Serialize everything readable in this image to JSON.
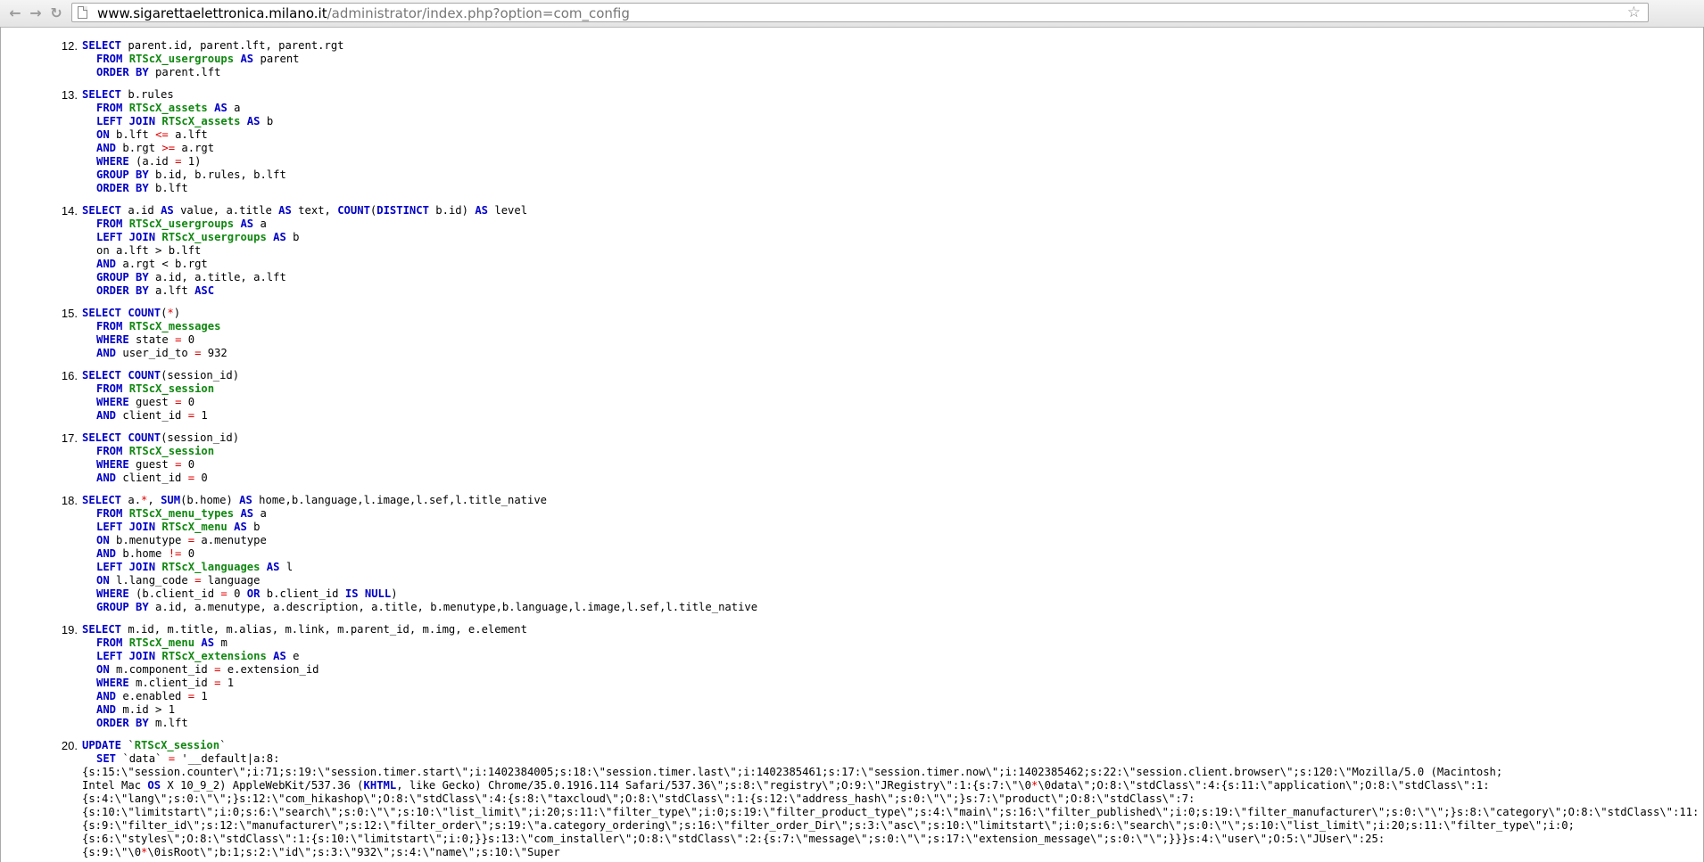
{
  "browser": {
    "url_host": "www.sigarettaelettronica.milano.it",
    "url_path": "/administrator/index.php?option=com_config",
    "back_icon": "arrow-left-icon",
    "forward_icon": "arrow-right-icon",
    "reload_icon": "reload-icon",
    "star_icon": "star-icon"
  },
  "colors": {
    "keyword": "#0000c8",
    "table": "#118811",
    "operator": "#e00000"
  },
  "queries": [
    {
      "num": "12.",
      "lines": [
        "[[SELECT]] parent.id, parent.lft, parent.rgt",
        "  [[FROM]] {{RTScX_usergroups}} [[AS]] parent",
        "  [[ORDER BY]] parent.lft"
      ]
    },
    {
      "num": "13.",
      "lines": [
        "[[SELECT]] b.rules",
        "  [[FROM]] {{RTScX_assets}} [[AS]] a",
        "  [[LEFT JOIN]] {{RTScX_assets}} [[AS]] b",
        "  [[ON]] b.lft <= a.lft",
        "  [[AND]] b.rgt >= a.rgt",
        "  [[WHERE]] (a.id = 1)",
        "  [[GROUP BY]] b.id, b.rules, b.lft",
        "  [[ORDER BY]] b.lft"
      ]
    },
    {
      "num": "14.",
      "lines": [
        "[[SELECT]] a.id [[AS]] value, a.title [[AS]] text, [[COUNT]]([[DISTINCT]] b.id) [[AS]] level",
        "  [[FROM]] {{RTScX_usergroups}} [[AS]] a",
        "  [[LEFT JOIN]] {{RTScX_usergroups}} [[AS]] b",
        "  on a.lft > b.lft",
        "  [[AND]] a.rgt < b.rgt",
        "  [[GROUP BY]] a.id, a.title, a.lft",
        "  [[ORDER BY]] a.lft [[ASC]]"
      ]
    },
    {
      "num": "15.",
      "lines": [
        "[[SELECT]] [[COUNT]](*)",
        "  [[FROM]] {{RTScX_messages}}",
        "  [[WHERE]] state = 0",
        "  [[AND]] user_id_to = 932"
      ]
    },
    {
      "num": "16.",
      "lines": [
        "[[SELECT]] [[COUNT]](session_id)",
        "  [[FROM]] {{RTScX_session}}",
        "  [[WHERE]] guest = 0",
        "  [[AND]] client_id = 1"
      ]
    },
    {
      "num": "17.",
      "lines": [
        "[[SELECT]] [[COUNT]](session_id)",
        "  [[FROM]] {{RTScX_session}}",
        "  [[WHERE]] guest = 0",
        "  [[AND]] client_id = 0"
      ]
    },
    {
      "num": "18.",
      "lines": [
        "[[SELECT]] a.*, [[SUM]](b.home) [[AS]] home,b.language,l.image,l.sef,l.title_native",
        "  [[FROM]] {{RTScX_menu_types}} [[AS]] a",
        "  [[LEFT JOIN]] {{RTScX_menu}} [[AS]] b",
        "  [[ON]] b.menutype = a.menutype",
        "  [[AND]] b.home != 0",
        "  [[LEFT JOIN]] {{RTScX_languages}} [[AS]] l",
        "  [[ON]] l.lang_code = language",
        "  [[WHERE]] (b.client_id = 0 [[OR]] b.client_id [[IS NULL]])",
        "  [[GROUP BY]] a.id, a.menutype, a.description, a.title, b.menutype,b.language,l.image,l.sef,l.title_native"
      ]
    },
    {
      "num": "19.",
      "lines": [
        "[[SELECT]] m.id, m.title, m.alias, m.link, m.parent_id, m.img, e.element",
        "  [[FROM]] {{RTScX_menu}} [[AS]] m",
        "  [[LEFT JOIN]] {{RTScX_extensions}} [[AS]] e",
        "  [[ON]] m.component_id = e.extension_id",
        "  [[WHERE]] m.client_id = 1",
        "  [[AND]] e.enabled = 1",
        "  [[AND]] m.id > 1",
        "  [[ORDER BY]] m.lft"
      ]
    },
    {
      "num": "20.",
      "lines": [
        "[[UPDATE]] `{{RTScX_session}}`",
        "  [[SET]] `data` = '__default|a:8:",
        "{s:15:\\\"session.counter\\\";i:71;s:19:\\\"session.timer.start\\\";i:1402384005;s:18:\\\"session.timer.last\\\";i:1402385461;s:17:\\\"session.timer.now\\\";i:1402385462;s:22:\\\"session.client.browser\\\";s:120:\\\"Mozilla/5.0 (Macintosh;",
        "Intel Mac [[OS]] X 10_9_2) AppleWebKit/537.36 ([[KHTML]], like Gecko) Chrome/35.0.1916.114 Safari/537.36\\\";s:8:\\\"registry\\\";O:9:\\\"JRegistry\\\":1:{s:7:\\\"\\0*\\0data\\\";O:8:\\\"stdClass\\\":4:{s:11:\\\"application\\\";O:8:\\\"stdClass\\\":1:",
        "{s:4:\\\"lang\\\";s:0:\\\"\\\";}s:12:\\\"com_hikashop\\\";O:8:\\\"stdClass\\\":4:{s:8:\\\"taxcloud\\\";O:8:\\\"stdClass\\\":1:{s:12:\\\"address_hash\\\";s:0:\\\"\\\";}s:7:\\\"product\\\";O:8:\\\"stdClass\\\":7:",
        "{s:10:\\\"limitstart\\\";i:0;s:6:\\\"search\\\";s:0:\\\"\\\";s:10:\\\"list_limit\\\";i:20;s:11:\\\"filter_type\\\";i:0;s:19:\\\"filter_product_type\\\";s:4:\\\"main\\\";s:16:\\\"filter_published\\\";i:0;s:19:\\\"filter_manufacturer\\\";s:0:\\\"\\\";}s:8:\\\"category\\\";O:8:\\\"stdClass\\\":11:",
        "{s:9:\\\"filter_id\\\";s:12:\\\"manufacturer\\\";s:12:\\\"filter_order\\\";s:19:\\\"a.category_ordering\\\";s:16:\\\"filter_order_Dir\\\";s:3:\\\"asc\\\";s:10:\\\"limitstart\\\";i:0;s:6:\\\"search\\\";s:0:\\\"\\\";s:10:\\\"list_limit\\\";i:20;s:11:\\\"filter_type\\\";i:0;",
        "{s:6:\\\"styles\\\";O:8:\\\"stdClass\\\":1:{s:10:\\\"limitstart\\\";i:0;}}s:13:\\\"com_installer\\\";O:8:\\\"stdClass\\\":2:{s:7:\\\"message\\\";s:0:\\\"\\\";s:17:\\\"extension_message\\\";s:0:\\\"\\\";}}}s:4:\\\"user\\\";O:5:\\\"JUser\\\":25:",
        "{s:9:\\\"\\0*\\0isRoot\\\";b:1;s:2:\\\"id\\\";s:3:\\\"932\\\";s:4:\\\"name\\\";s:10:\\\"Super"
      ]
    }
  ]
}
